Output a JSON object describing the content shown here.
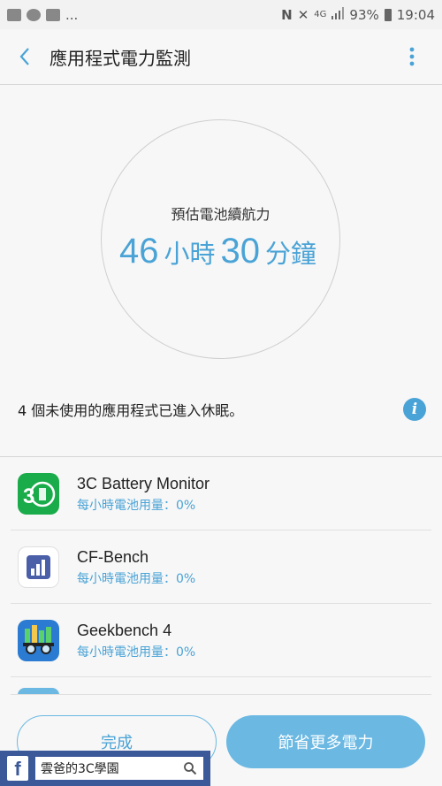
{
  "status_bar": {
    "ellipsis": "...",
    "signal_text": "4G",
    "battery_percent": "93%",
    "time": "19:04"
  },
  "app_bar": {
    "title": "應用程式電力監測"
  },
  "battery_estimate": {
    "label": "預估電池續航力",
    "hours": "46",
    "hours_unit": "小時",
    "minutes": "30",
    "minutes_unit": "分鐘"
  },
  "info": {
    "text": "4 個未使用的應用程式已進入休眠。"
  },
  "apps": [
    {
      "name": "3C Battery Monitor",
      "usage": "每小時電池用量：0%"
    },
    {
      "name": "CF-Bench",
      "usage": "每小時電池用量：0%"
    },
    {
      "name": "Geekbench 4",
      "usage": "每小時電池用量：0%"
    }
  ],
  "buttons": {
    "done": "完成",
    "save_more": "節省更多電力"
  },
  "watermark": {
    "logo": "f",
    "search_text": "雲爸的3C學園"
  },
  "colors": {
    "accent": "#4aa3d6",
    "button_fill": "#6bb8e2",
    "facebook": "#3b5998"
  }
}
